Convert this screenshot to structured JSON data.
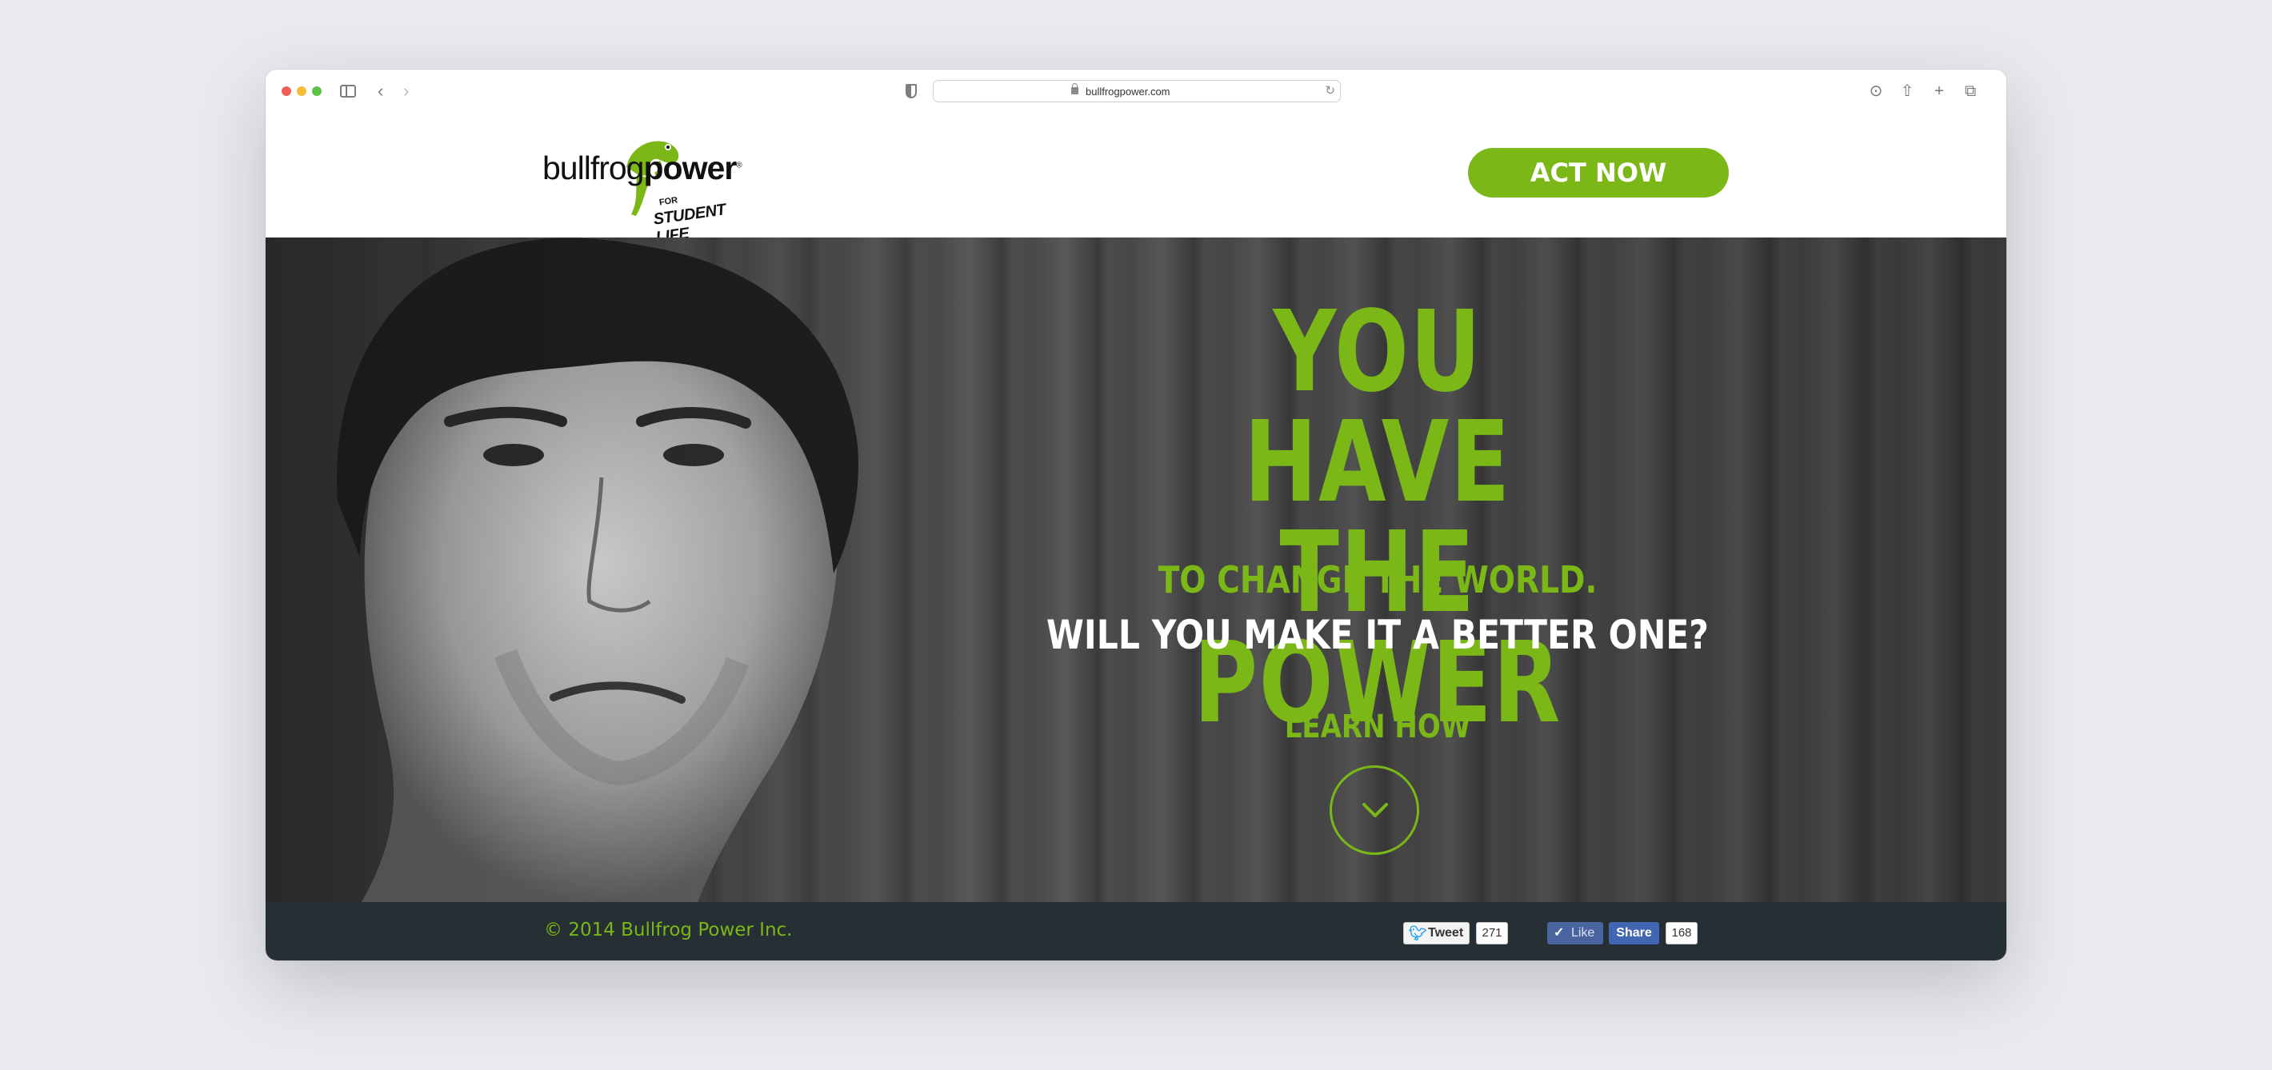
{
  "browser": {
    "url": "bullfrogpower.com"
  },
  "header": {
    "logo": {
      "word_light": "bullfrog",
      "word_bold": "power",
      "registered": "®",
      "for": "FOR",
      "sub": "STUDENT LIFE"
    },
    "cta_label": "ACT NOW"
  },
  "hero": {
    "headline_line1": "YOU HAVE",
    "headline_line2": "THE POWER",
    "subline1": "TO CHANGE THE WORLD.",
    "subline2": "WILL YOU MAKE IT A BETTER ONE?",
    "learn_label": "LEARN HOW"
  },
  "footer": {
    "copyright": "© 2014 Bullfrog Power Inc.",
    "tweet_label": "Tweet",
    "tweet_count": "271",
    "like_label": "Like",
    "share_label": "Share",
    "share_count": "168"
  },
  "colors": {
    "brand_green": "#7ab717",
    "footer_bg": "#262f33",
    "facebook_blue": "#4267b2"
  },
  "icons": [
    "sidebar-icon",
    "back-icon",
    "forward-icon",
    "shield-icon",
    "lock-icon",
    "reload-icon",
    "download-icon",
    "share-icon",
    "new-tab-icon",
    "tabs-icon",
    "frog-icon",
    "chevron-down-icon",
    "twitter-bird-icon",
    "check-icon"
  ]
}
